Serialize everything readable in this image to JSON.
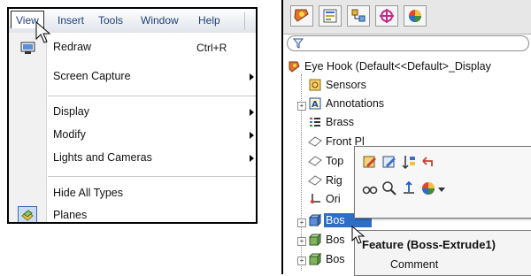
{
  "menubar": {
    "items": [
      "View",
      "Insert",
      "Tools",
      "Window",
      "Help"
    ]
  },
  "view_menu": {
    "items": [
      {
        "label": "Redraw",
        "shortcut": "Ctrl+R"
      },
      {
        "label": "Screen Capture"
      },
      {
        "label": "Display"
      },
      {
        "label": "Modify"
      },
      {
        "label": "Lights and Cameras"
      },
      {
        "label": "Hide All Types"
      },
      {
        "label": "Planes"
      }
    ]
  },
  "feature_tree": {
    "root": "Eye Hook  (Default<<Default>_Display",
    "items": [
      "Sensors",
      "Annotations",
      "Brass",
      "Front Pl",
      "Top",
      "Rig",
      "Ori",
      "Bos",
      "Bos",
      "Bos"
    ]
  },
  "tooltip": {
    "title": "Feature (Boss-Extrude1)",
    "comment": "Comment"
  },
  "colors": {
    "menu_text": "#1f3f7a",
    "tree_text": "#111111",
    "accent": "#0a58b8"
  }
}
